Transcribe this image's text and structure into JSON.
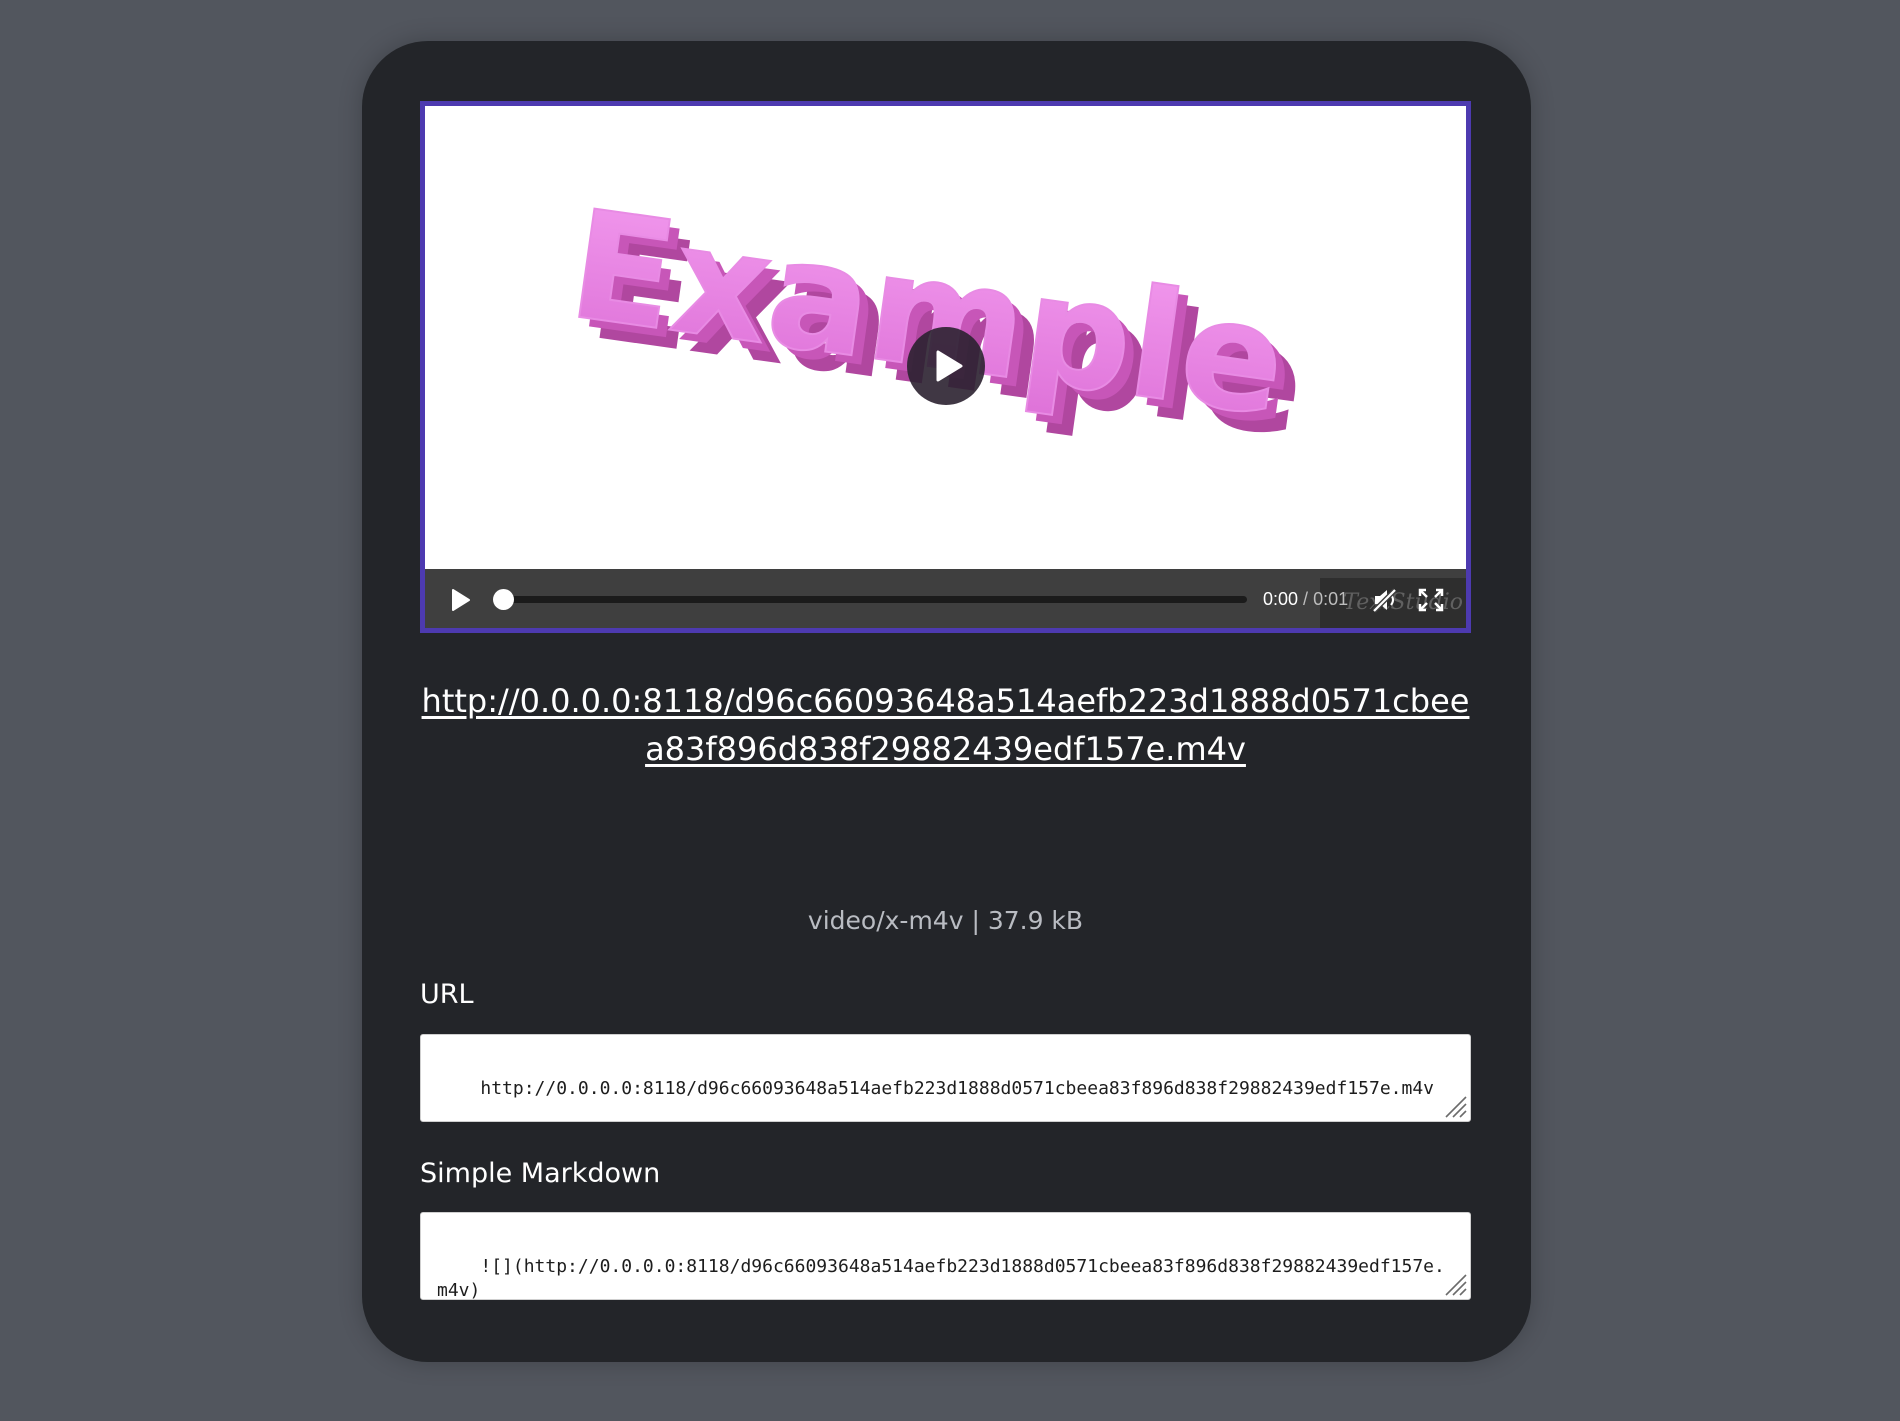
{
  "player": {
    "video_text": "Example",
    "current_time": "0:00",
    "separator": " / ",
    "duration": "0:01",
    "progress": 0.0,
    "muted": true,
    "watermark": "TextStudio",
    "accent_color": "#4d3ab0"
  },
  "file": {
    "link": "http://0.0.0.0:8118/d96c66093648a514aefb223d1888d0571cbeea83f896d838f29882439edf157e.m4v",
    "meta": "video/x-m4v | 37.9 kB"
  },
  "url_field": {
    "label": "URL",
    "value": "http://0.0.0.0:8118/d96c66093648a514aefb223d1888d0571cbeea83f896d838f29882439edf157e.m4v"
  },
  "markdown_field": {
    "label": "Simple Markdown",
    "value": "![](http://0.0.0.0:8118/d96c66093648a514aefb223d1888d0571cbeea83f896d838f29882439edf157e.m4v)"
  },
  "icons": [
    "play-icon",
    "volume-muted-icon",
    "fullscreen-icon",
    "resize-grip-icon"
  ]
}
